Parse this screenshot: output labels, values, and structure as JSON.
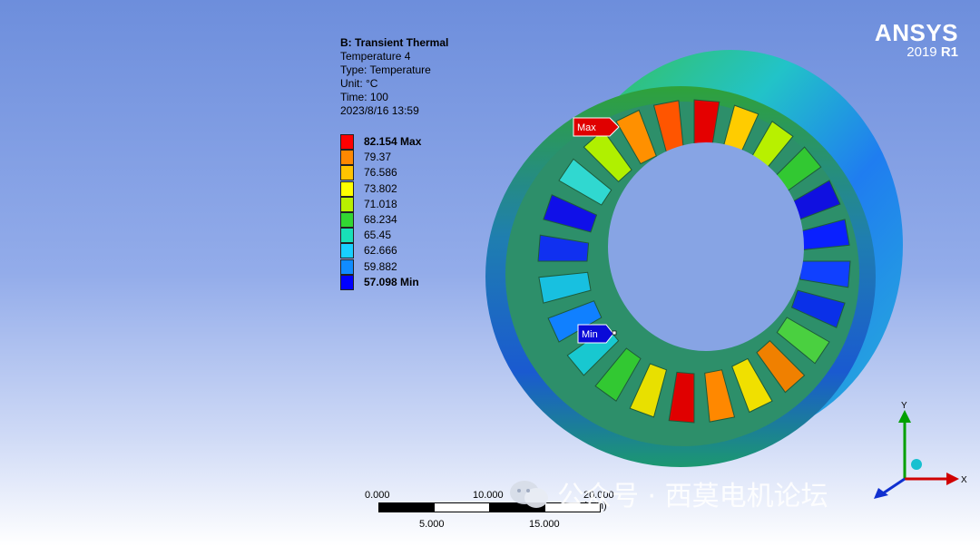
{
  "info": {
    "title": "B: Transient Thermal",
    "result": "Temperature 4",
    "type": "Type: Temperature",
    "unit": "Unit: °C",
    "time": "Time: 100",
    "date": "2023/8/16 13:59"
  },
  "legend": [
    {
      "label": "82.154 Max",
      "color": "#ff0000",
      "bold": true
    },
    {
      "label": "79.37",
      "color": "#ff8800",
      "bold": false
    },
    {
      "label": "76.586",
      "color": "#ffc400",
      "bold": false
    },
    {
      "label": "73.802",
      "color": "#ffff00",
      "bold": false
    },
    {
      "label": "71.018",
      "color": "#b8f000",
      "bold": false
    },
    {
      "label": "68.234",
      "color": "#32d732",
      "bold": false
    },
    {
      "label": "65.45",
      "color": "#18e0b8",
      "bold": false
    },
    {
      "label": "62.666",
      "color": "#18d0ff",
      "bold": false
    },
    {
      "label": "59.882",
      "color": "#108cff",
      "bold": false
    },
    {
      "label": "57.098 Min",
      "color": "#0000ff",
      "bold": true
    }
  ],
  "logo": {
    "brand": "ANSYS",
    "version": "2019",
    "release": "R1"
  },
  "probes": {
    "max": "Max",
    "min": "Min"
  },
  "scale": {
    "top": [
      "0.000",
      "10.000",
      "20.000 (mm)"
    ],
    "bottom": [
      "5.000",
      "15.000"
    ]
  },
  "triad": {
    "x": "X",
    "y": "Y"
  },
  "watermark": "公众号 · 西莫电机论坛"
}
